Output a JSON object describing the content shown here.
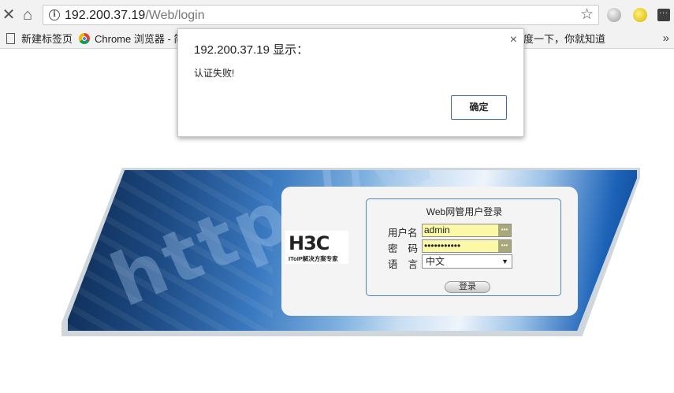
{
  "browser": {
    "url_host": "192.200.37.19",
    "url_path": "/Web/login",
    "bookmarks": [
      {
        "label": "新建标签页"
      },
      {
        "label": "Chrome 浏览器 - 简"
      },
      {
        "label": "度一下，你就知道"
      }
    ],
    "more_label": "»"
  },
  "login": {
    "logo_text": "H3C",
    "logo_subtext": "IToIP解决方案专家",
    "form_title": "Web网管用户登录",
    "username_label": "用户名",
    "username_value": "admin",
    "password_label": "密  码",
    "password_value": "•••••••••••",
    "language_label": "语  言",
    "language_value": "中文",
    "login_button": "登录",
    "banner_text": "http://www"
  },
  "dialog": {
    "title": "192.200.37.19 显示：",
    "message": "认证失败!",
    "ok_label": "确定",
    "close_label": "×"
  },
  "colors": {
    "field_bg": "#fbf9a8",
    "form_border": "#4f86b7",
    "button_border": "#3b6aa0"
  }
}
